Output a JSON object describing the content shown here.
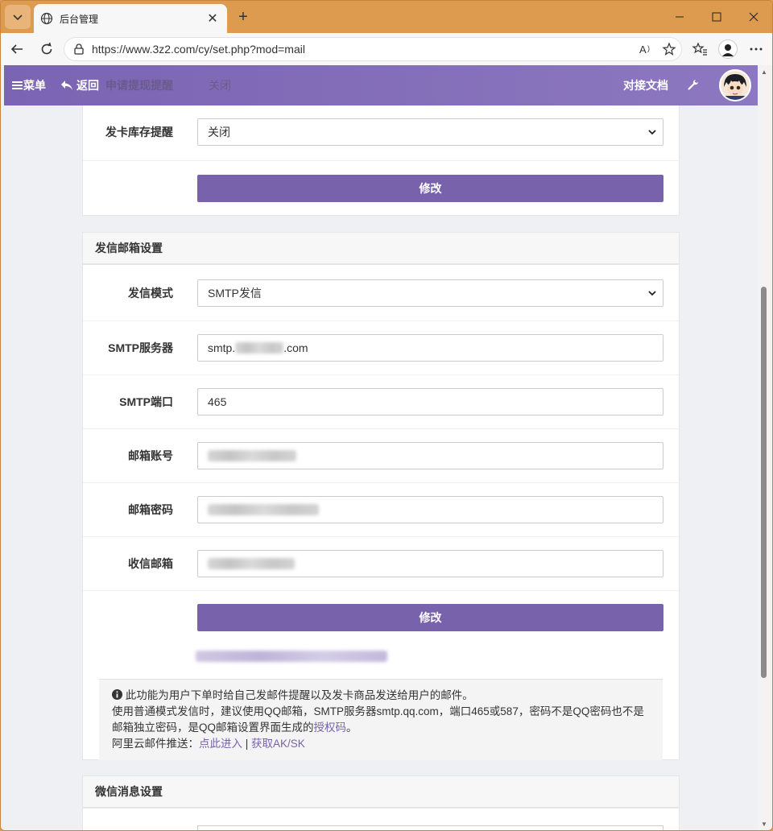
{
  "browser": {
    "tab_title": "后台管理",
    "url": "https://www.3z2.com/cy/set.php?mod=mail"
  },
  "app_header": {
    "menu_label": "菜单",
    "back_label": "返回",
    "docs_label": "对接文档",
    "behind_label": "申请提现提醒",
    "behind_value": "关闭"
  },
  "stock_panel": {
    "stock_label": "发卡库存提醒",
    "stock_value": "关闭",
    "submit_label": "修改"
  },
  "mail_panel": {
    "title": "发信邮箱设置",
    "mode_label": "发信模式",
    "mode_value": "SMTP发信",
    "server_label": "SMTP服务器",
    "server_prefix": "smtp.",
    "server_suffix": ".com",
    "port_label": "SMTP端口",
    "port_value": "465",
    "account_label": "邮箱账号",
    "password_label": "邮箱密码",
    "receiver_label": "收信邮箱",
    "submit_label": "修改",
    "note_line1": "此功能为用户下单时给自己发邮件提醒以及发卡商品发送给用户的邮件。",
    "note_line2": "使用普通模式发信时，建议使用QQ邮箱，SMTP服务器smtp.qq.com，端口465或587，密码不是QQ密码也不是邮箱独立密码，是QQ邮箱设置界面生成的",
    "note_link_auth": "授权码",
    "note_line2_end": "。",
    "note_line3_prefix": "阿里云邮件推送：",
    "note_link_enter": "点此进入",
    "note_sep": " | ",
    "note_link_aksk": "获取AK/SK"
  },
  "wechat_panel": {
    "title": "微信消息设置"
  },
  "colors": {
    "accent": "#7862ac",
    "header": "#8370bb",
    "browser_frame": "#dd9b4f"
  }
}
